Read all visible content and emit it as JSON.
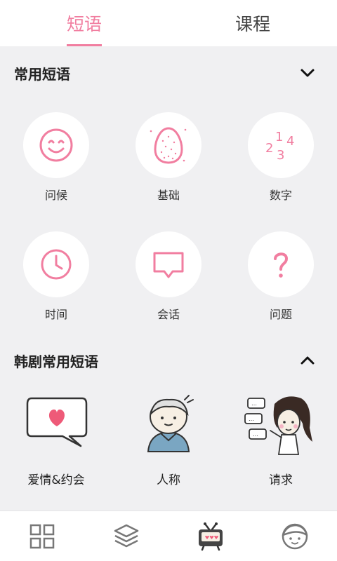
{
  "tabs": {
    "left": "短语",
    "right": "课程"
  },
  "section1": {
    "title": "常用短语",
    "items": [
      "问候",
      "基础",
      "数字",
      "时间",
      "会话",
      "问题"
    ]
  },
  "section2": {
    "title": "韩剧常用短语",
    "items": [
      "爱情&约会",
      "人称",
      "请求"
    ]
  },
  "numbers_icon": {
    "d1": "1",
    "d2": "2",
    "d3": "3",
    "d4": "4"
  },
  "colors": {
    "accent": "#f17ea0",
    "background": "#f0f0f2",
    "icon_gray": "#777777"
  },
  "bottom_nav": [
    "grid-icon",
    "layers-icon",
    "tv-icon",
    "profile-face-icon"
  ]
}
